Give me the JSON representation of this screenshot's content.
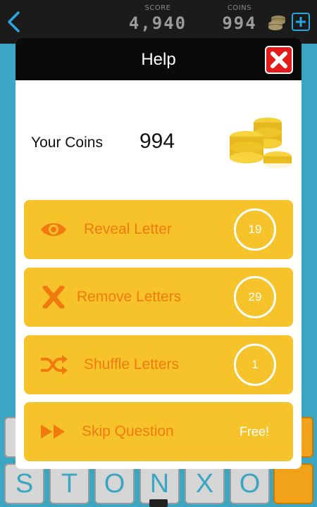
{
  "topbar": {
    "score_label": "SCORE",
    "score_value": "4,940",
    "coins_label": "COINS",
    "coins_value": "994"
  },
  "tiles": {
    "bottom_letters": [
      "S",
      "T",
      "O",
      "N",
      "X",
      "O"
    ]
  },
  "modal": {
    "title": "Help",
    "your_coins_label": "Your Coins",
    "your_coins_value": "994",
    "options": [
      {
        "label": "Reveal Letter",
        "cost": "19",
        "icon": "eye-icon"
      },
      {
        "label": "Remove Letters",
        "cost": "29",
        "icon": "x-icon"
      },
      {
        "label": "Shuffle Letters",
        "cost": "1",
        "icon": "shuffle-icon"
      },
      {
        "label": "Skip Question",
        "cost": "Free!",
        "icon": "fast-forward-icon"
      }
    ]
  },
  "colors": {
    "option_bg": "#f7c32a",
    "option_text": "#f07a10",
    "close_red": "#e31b1b",
    "accent_blue": "#2aa6e0",
    "background_teal": "#3aa6c4"
  }
}
